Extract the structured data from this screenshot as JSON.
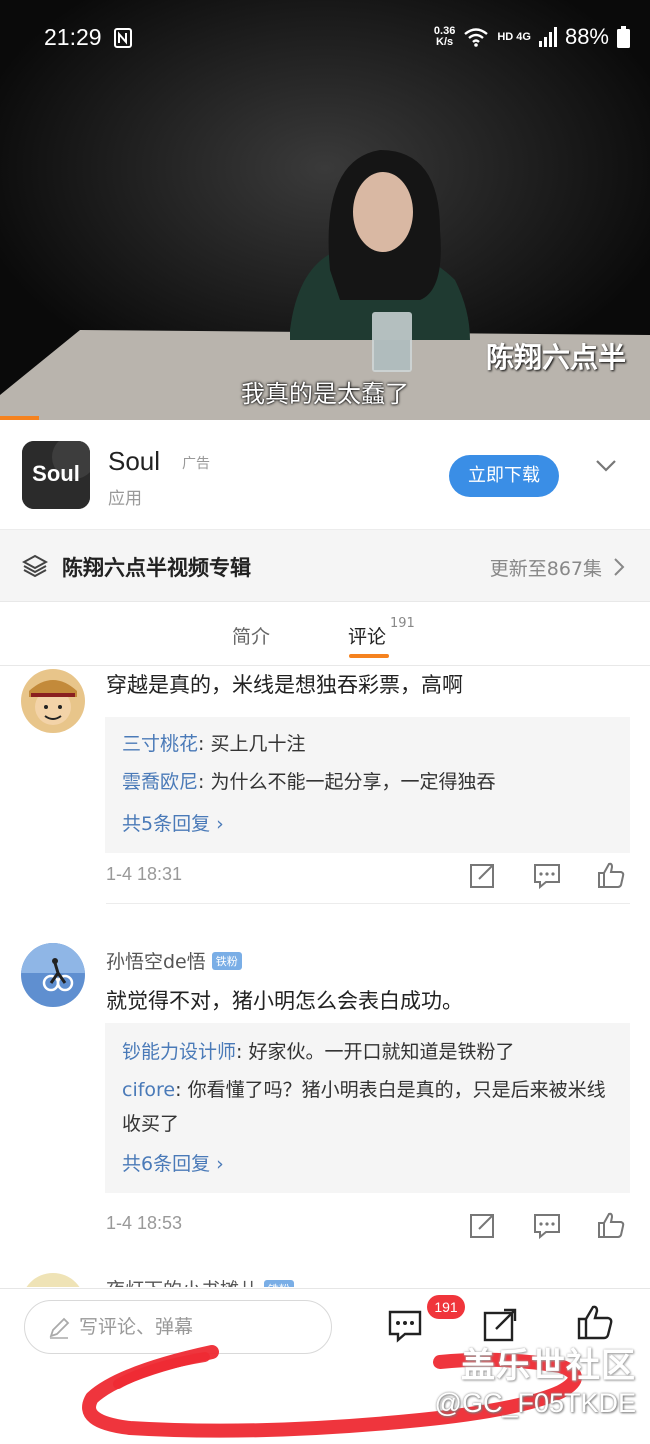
{
  "status_bar": {
    "time": "21:29",
    "net_speed_value": "0.36",
    "net_speed_unit": "K/s",
    "network": "HD 4G",
    "battery": "88%"
  },
  "video": {
    "subtitle": "我真的是太蠢了",
    "channel_logo": "陈翔六点半",
    "progress": 0.06
  },
  "ad": {
    "app_icon_text": "Soul",
    "app_name": "Soul",
    "tag": "广告",
    "category": "应用",
    "download_button": "立即下载"
  },
  "album": {
    "title": "陈翔六点半视频专辑",
    "update_text": "更新至867集"
  },
  "tabs": {
    "intro": "简介",
    "comments": "评论",
    "comment_count": "191"
  },
  "comments": [
    {
      "username": "",
      "badge": "",
      "text": "穿越是真的，米线是想独吞彩票，高啊",
      "replies": [
        {
          "name": "三寸桃花",
          "text": ": 买上几十注"
        },
        {
          "name": "雲喬欧尼",
          "text": ": 为什么不能一起分享，一定得独吞"
        }
      ],
      "more_replies": "共5条回复",
      "time": "1-4 18:31"
    },
    {
      "username": "孙悟空de悟",
      "badge": "铁粉",
      "text": "就觉得不对，猪小明怎么会表白成功。",
      "replies": [
        {
          "name": "钞能力设计师",
          "text": ": 好家伙。一开口就知道是铁粉了"
        },
        {
          "name": "cifore",
          "text": ": 你看懂了吗？猪小明表白是真的，只是后来被米线收买了"
        }
      ],
      "more_replies": "共6条回复",
      "time": "1-4 18:53"
    },
    {
      "username": "夜灯下的小书摊儿",
      "badge": "铁粉"
    }
  ],
  "bottom_bar": {
    "input_placeholder": "写评论、弹幕",
    "comment_badge": "191"
  },
  "watermarks": {
    "forum": "盖乐世社区",
    "user": "@GC_F05TKDE"
  },
  "colors": {
    "accent_orange": "#f5821f",
    "button_blue": "#3a8ee6",
    "link_blue": "#4a7ab8",
    "badge_red": "#f0353b",
    "annotation_red": "#ee2a33"
  },
  "icons": [
    "nfc-icon",
    "wifi-icon",
    "signal-icon",
    "battery-icon",
    "chevron-down-icon",
    "layers-icon",
    "chevron-right-icon",
    "share-icon",
    "comment-icon",
    "like-icon",
    "pen-icon"
  ]
}
